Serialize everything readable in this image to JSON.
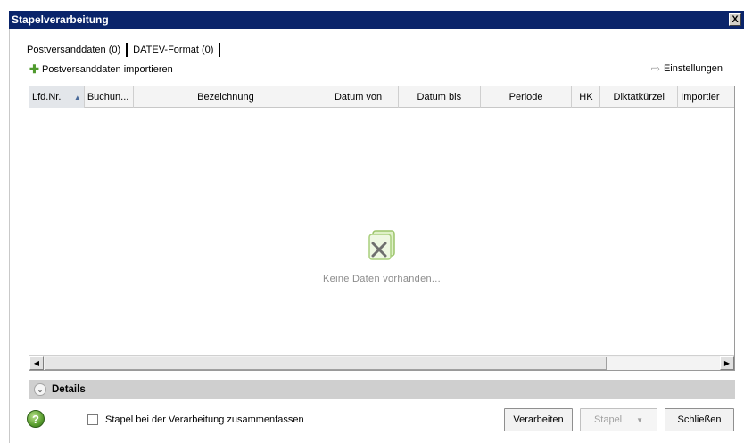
{
  "window": {
    "title": "Stapelverarbeitung",
    "close_label": "X"
  },
  "tabs": [
    {
      "label": "Postversanddaten (0)"
    },
    {
      "label": "DATEV-Format (0)"
    }
  ],
  "toolbar": {
    "import_label": "Postversanddaten importieren",
    "settings_label": "Einstellungen"
  },
  "grid": {
    "columns": [
      {
        "label": "Lfd.Nr."
      },
      {
        "label": "Buchun..."
      },
      {
        "label": "Bezeichnung"
      },
      {
        "label": "Datum von"
      },
      {
        "label": "Datum bis"
      },
      {
        "label": "Periode"
      },
      {
        "label": "HK"
      },
      {
        "label": "Diktatkürzel"
      },
      {
        "label": "Importier"
      }
    ],
    "empty_text": "Keine Daten vorhanden..."
  },
  "details": {
    "label": "Details"
  },
  "footer": {
    "checkbox_label": "Stapel bei der Verarbeitung zusammenfassen",
    "process_label": "Verarbeiten",
    "batch_label": "Stapel",
    "close_label": "Schließen"
  },
  "colors": {
    "titlebar": "#0a246a",
    "accent_green": "#4f9a2d"
  }
}
